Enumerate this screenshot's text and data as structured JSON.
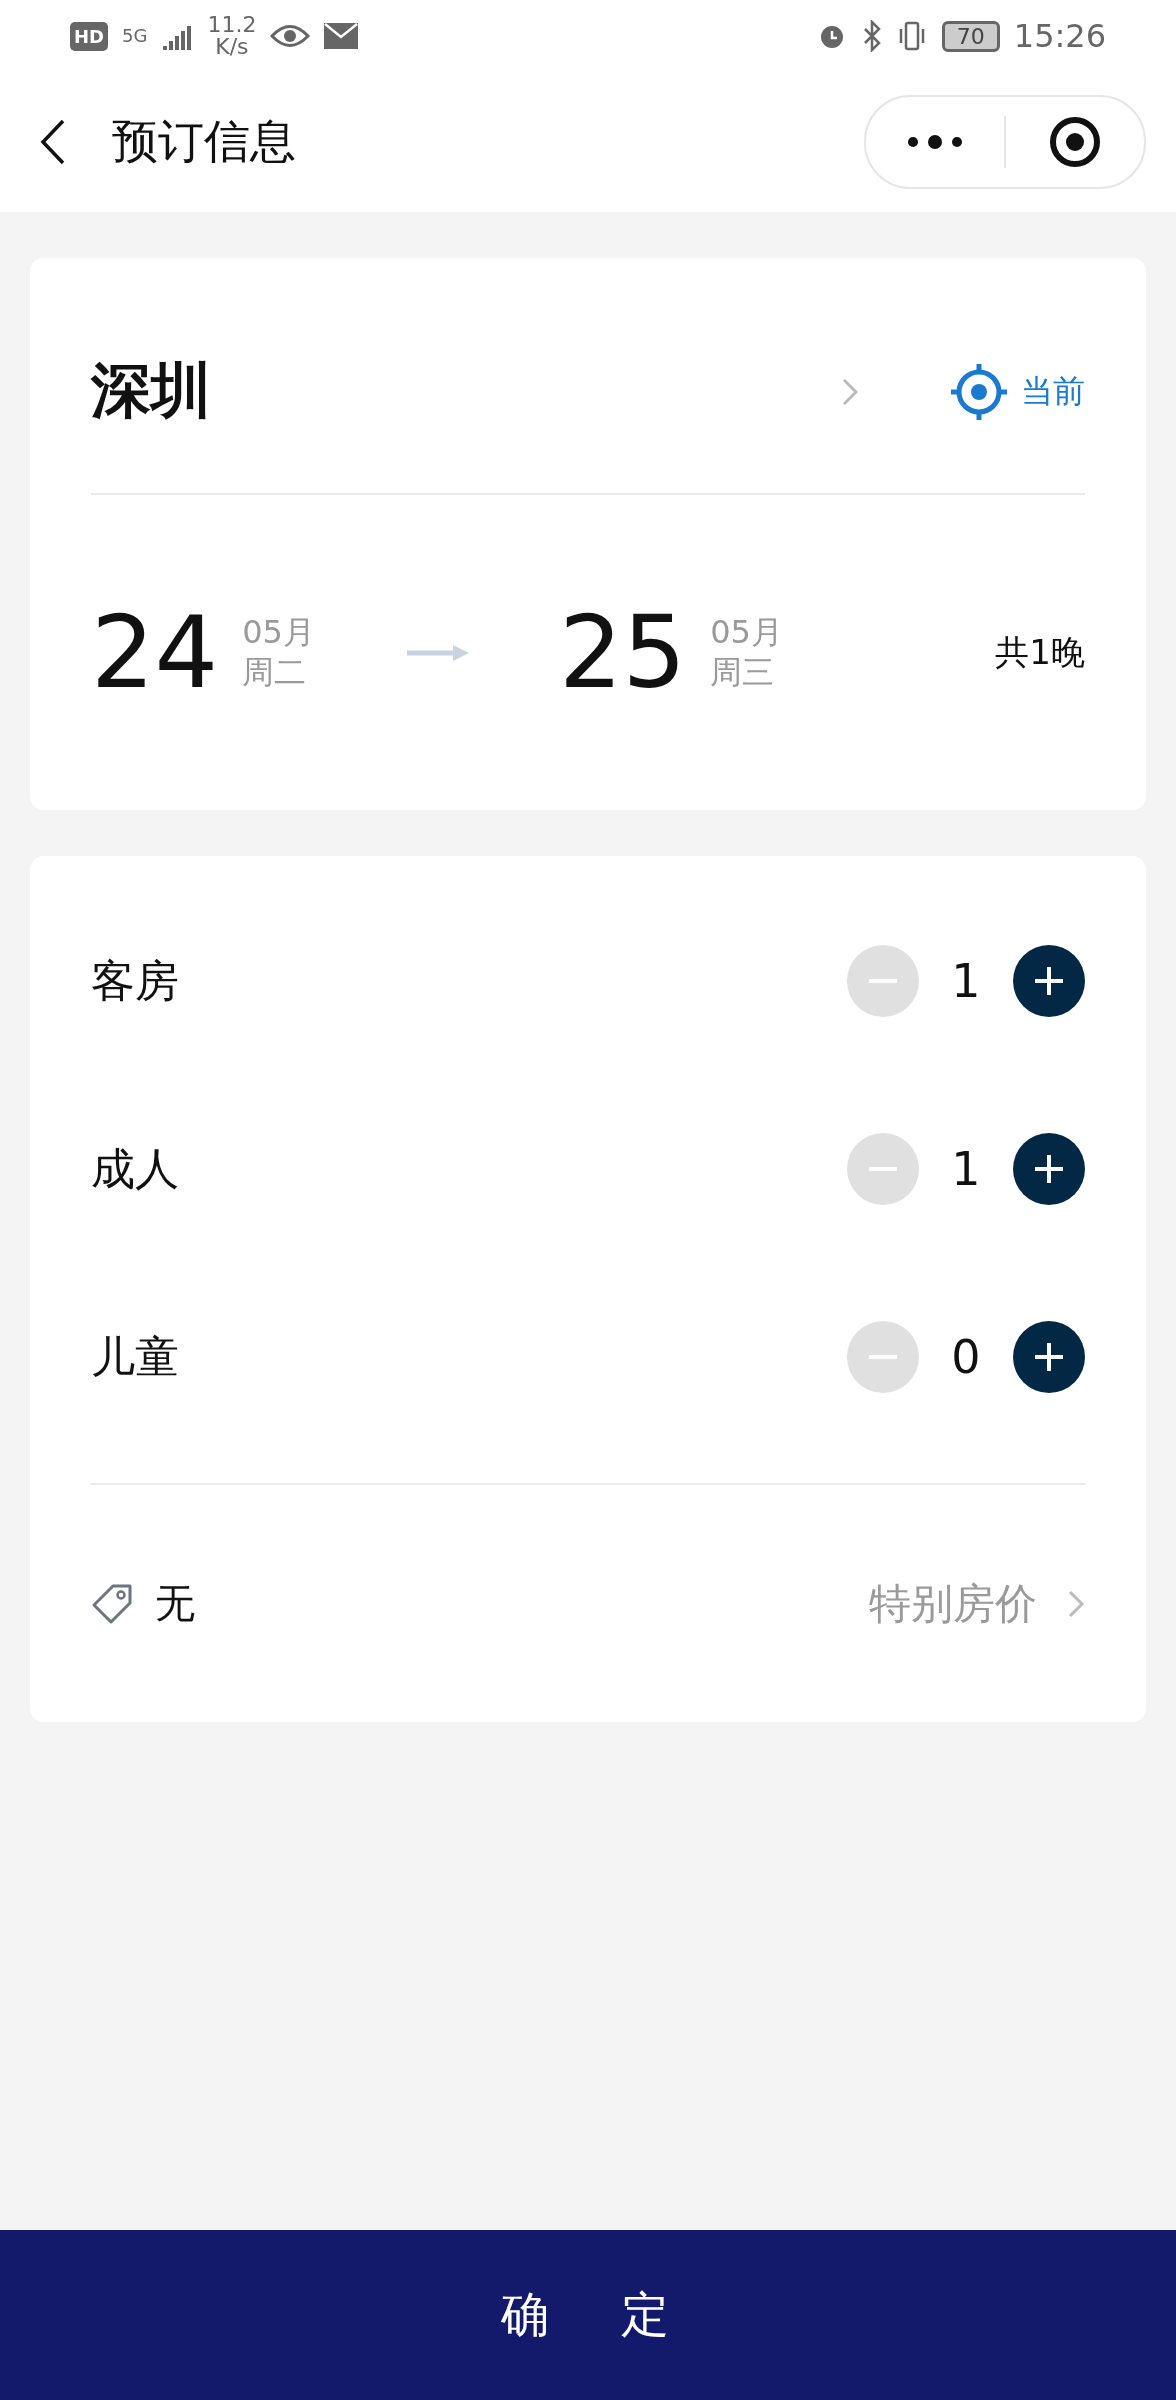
{
  "status_bar": {
    "hd": "HD",
    "network": "5G",
    "speed": "11.2",
    "speed_unit": "K/s",
    "battery": "70",
    "time": "15:26"
  },
  "header": {
    "title": "预订信息"
  },
  "destination": {
    "city": "深圳",
    "locate_label": "当前"
  },
  "stay": {
    "check_in": {
      "day": "24",
      "month": "05月",
      "weekday": "周二"
    },
    "check_out": {
      "day": "25",
      "month": "05月",
      "weekday": "周三"
    },
    "nights": "共1晚"
  },
  "counters": [
    {
      "label": "客房",
      "value": "1",
      "minus_disabled": true,
      "plus_disabled": false
    },
    {
      "label": "成人",
      "value": "1",
      "minus_disabled": true,
      "plus_disabled": false
    },
    {
      "label": "儿童",
      "value": "0",
      "minus_disabled": true,
      "plus_disabled": false
    }
  ],
  "rate": {
    "value": "无",
    "label": "特别房价"
  },
  "confirm_button": "确定"
}
